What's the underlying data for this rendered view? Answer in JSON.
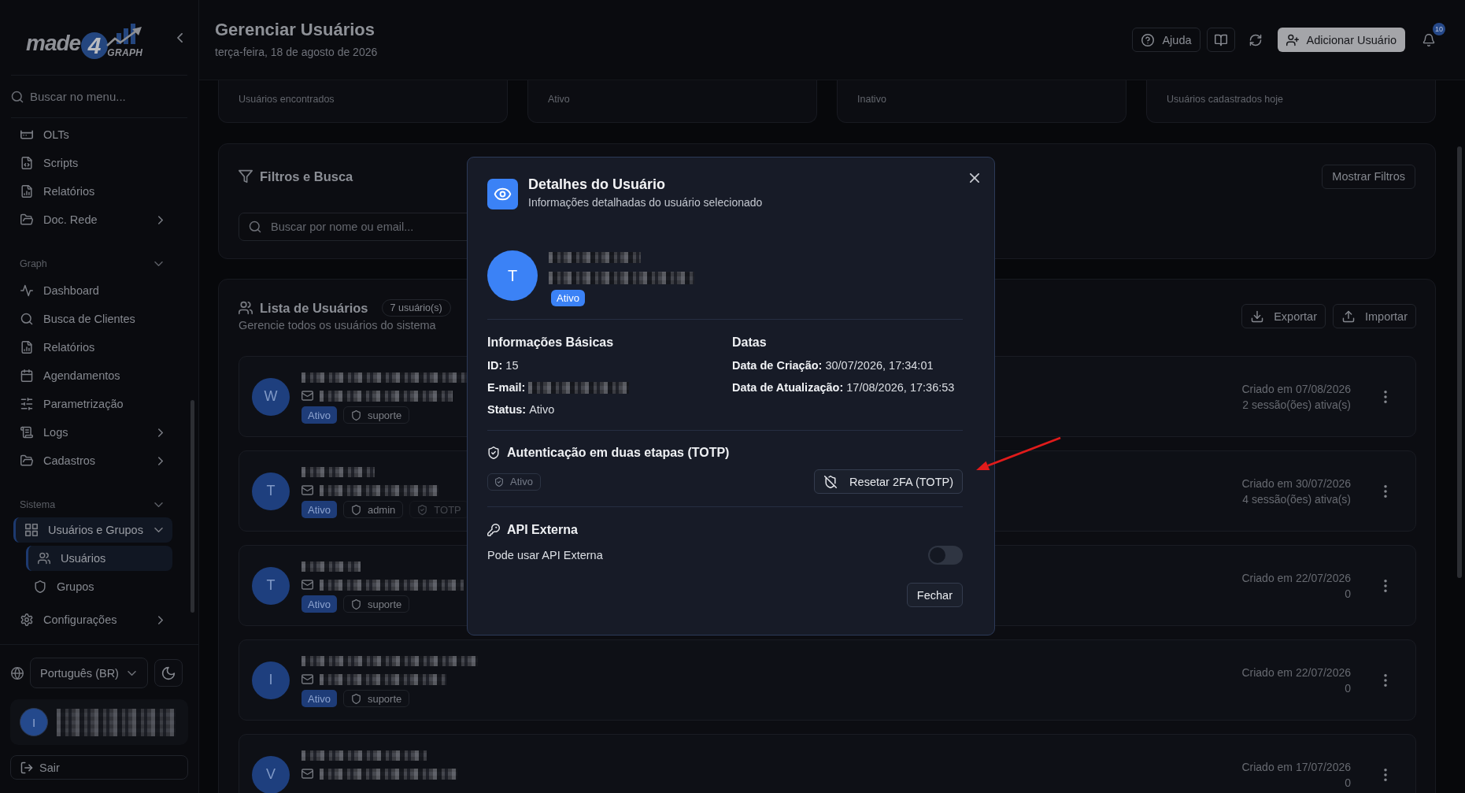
{
  "sidebar": {
    "logo": {
      "word": "made",
      "digit": "4",
      "tag": "GRAPH"
    },
    "search": {
      "placeholder": "Buscar no menu..."
    },
    "sections": [
      {
        "items": [
          {
            "label": "OLTs",
            "kind": "link",
            "selected": false
          },
          {
            "label": "Scripts",
            "kind": "link",
            "selected": false
          },
          {
            "label": "Relatórios",
            "kind": "link",
            "selected": false
          },
          {
            "label": "Doc. Rede",
            "kind": "group",
            "expanded": false,
            "selected": false
          }
        ]
      },
      {
        "title": "Graph",
        "expanded": true,
        "items": [
          {
            "label": "Dashboard",
            "kind": "link",
            "selected": false
          },
          {
            "label": "Busca de Clientes",
            "kind": "link",
            "selected": false
          },
          {
            "label": "Relatórios",
            "kind": "link",
            "selected": false
          },
          {
            "label": "Agendamentos",
            "kind": "link",
            "selected": false
          },
          {
            "label": "Parametrização",
            "kind": "link",
            "selected": false
          },
          {
            "label": "Logs",
            "kind": "group",
            "expanded": false,
            "selected": false
          },
          {
            "label": "Cadastros",
            "kind": "group",
            "expanded": false,
            "selected": false
          }
        ]
      },
      {
        "title": "Sistema",
        "expanded": true,
        "items": [
          {
            "label": "Usuários e Grupos",
            "kind": "group",
            "expanded": true,
            "selected": true,
            "children": [
              {
                "label": "Usuários",
                "selected": true
              },
              {
                "label": "Grupos",
                "selected": false
              }
            ]
          },
          {
            "label": "Configurações",
            "kind": "group",
            "expanded": false,
            "selected": false
          }
        ]
      }
    ],
    "language": "Português (BR)",
    "user": {
      "initial": "I"
    },
    "logout": "Sair"
  },
  "header": {
    "title": "Gerenciar Usuários",
    "date": "terça-feira, 18 de agosto de 2026",
    "help_button": "Ajuda",
    "add_button": "Adicionar Usuário",
    "notifications": "10"
  },
  "stats": [
    {
      "label": "Usuários encontrados"
    },
    {
      "label": "Ativo"
    },
    {
      "label": "Inativo"
    },
    {
      "label": "Usuários cadastrados hoje"
    }
  ],
  "filters": {
    "title": "Filtros e Busca",
    "search": {
      "placeholder": "Buscar por nome ou email..."
    },
    "toggle_button": "Mostrar Filtros"
  },
  "user_list": {
    "title": "Lista de Usuários",
    "count": "7 usuário(s)",
    "subtitle": "Gerencie todos os usuários do sistema",
    "export_button": "Exportar",
    "import_button": "Importar",
    "users": [
      {
        "initial": "W",
        "status": "Ativo",
        "tags": [
          {
            "kind": "role",
            "label": "suporte"
          }
        ],
        "created": "Criado em 07/08/2026",
        "sessions": "2 sessão(ões) ativa(s)"
      },
      {
        "initial": "T",
        "status": "Ativo",
        "tags": [
          {
            "kind": "role",
            "label": "admin"
          },
          {
            "kind": "totp",
            "label": "TOTP"
          }
        ],
        "created": "Criado em 30/07/2026",
        "sessions": "4 sessão(ões) ativa(s)"
      },
      {
        "initial": "T",
        "status": "Ativo",
        "tags": [
          {
            "kind": "role",
            "label": "suporte"
          }
        ],
        "created": "Criado em 22/07/2026",
        "sessions": "0"
      },
      {
        "initial": "I",
        "status": "Ativo",
        "tags": [
          {
            "kind": "role",
            "label": "suporte"
          }
        ],
        "created": "Criado em 22/07/2026",
        "sessions": "0"
      },
      {
        "initial": "V",
        "created": "Criado em 17/07/2026",
        "sessions": "0"
      }
    ]
  },
  "modal": {
    "title": "Detalhes do Usuário",
    "subtitle": "Informações detalhadas do usuário selecionado",
    "user": {
      "initial": "T",
      "status": "Ativo"
    },
    "basic": {
      "title": "Informações Básicas",
      "fields": [
        {
          "kind": "text",
          "label": "ID:",
          "value": "15"
        },
        {
          "kind": "redacted",
          "label": "E-mail:"
        },
        {
          "kind": "text",
          "label": "Status:",
          "value": "Ativo"
        }
      ]
    },
    "dates": {
      "title": "Datas",
      "fields": [
        {
          "kind": "text",
          "label": "Data de Criação:",
          "value": "30/07/2026, 17:34:01"
        },
        {
          "kind": "text",
          "label": "Data de Atualização:",
          "value": "17/08/2026, 17:36:53"
        }
      ]
    },
    "totp": {
      "title": "Autenticação em duas etapas (TOTP)",
      "status": "Ativo",
      "reset_button": "Resetar 2FA (TOTP)"
    },
    "api": {
      "title": "API Externa",
      "label": "Pode usar API Externa",
      "on": false
    },
    "close_button": "Fechar"
  }
}
